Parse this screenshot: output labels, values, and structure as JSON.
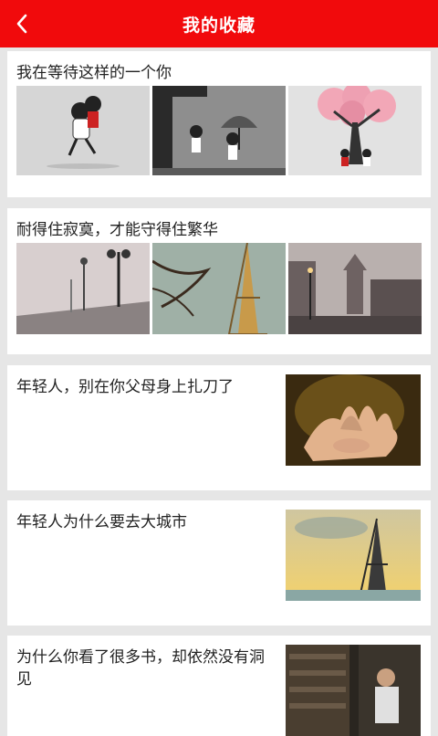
{
  "header": {
    "title": "我的收藏",
    "back_icon": "chevron-left-icon"
  },
  "articles": [
    {
      "title": "我在等待这样的一个你",
      "images": [
        "girl-carrying-boy-illustration",
        "couple-with-umbrella-in-rain-illustration",
        "couple-under-pink-tree-illustration"
      ]
    },
    {
      "title": "耐得住寂寞，才能守得住繁华",
      "images": [
        "misty-bridge-street-lamps-photo",
        "eiffel-tower-with-branches-photo",
        "european-square-rainy-photo"
      ]
    },
    {
      "title": "年轻人，别在你父母身上扎刀了",
      "images": [
        "hands-holding-hands-photo"
      ]
    },
    {
      "title": "年轻人为什么要去大城市",
      "images": [
        "eiffel-tower-sunset-photo"
      ]
    },
    {
      "title": "为什么你看了很多书，却依然没有洞见",
      "images": [
        "library-bookshelves-photo"
      ]
    }
  ],
  "colors": {
    "header": "#f10a0c",
    "background": "#e6e6e6",
    "card": "#ffffff"
  }
}
